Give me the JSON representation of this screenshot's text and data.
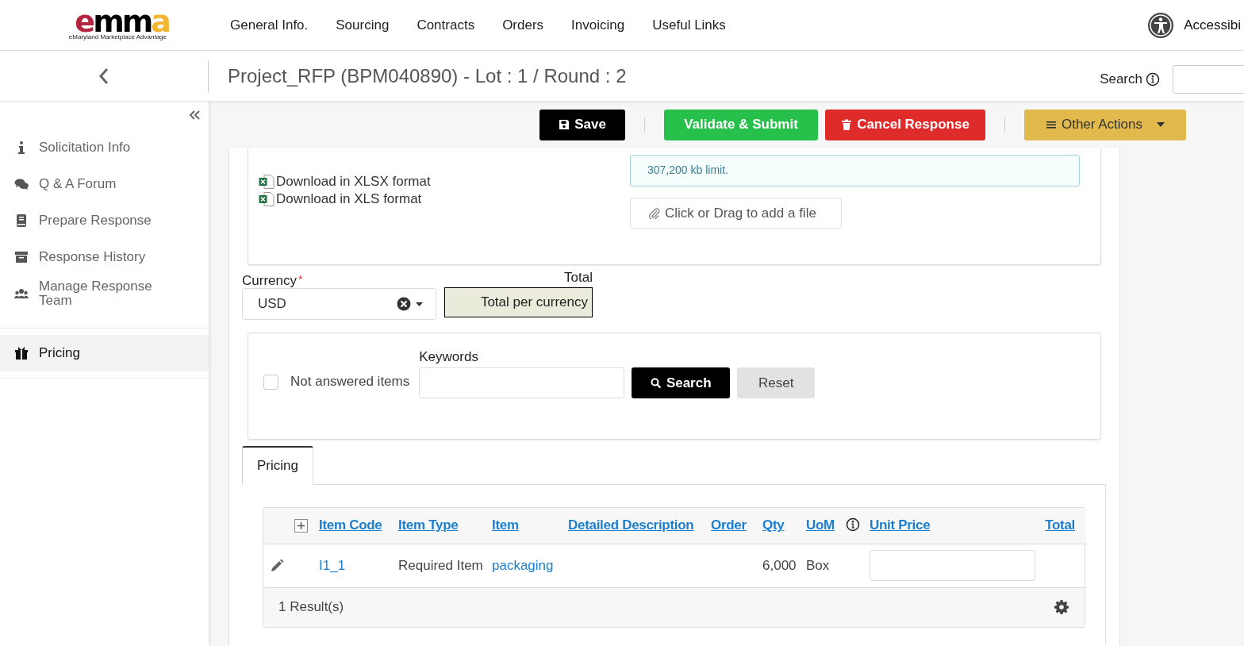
{
  "logo": {
    "text": "emma",
    "tagline": "eMaryland Marketplace Advantage"
  },
  "nav": [
    "General Info.",
    "Sourcing",
    "Contracts",
    "Orders",
    "Invoicing",
    "Useful Links"
  ],
  "accessibility": "Accessibi",
  "page_title": "Project_RFP (BPM040890) - Lot : 1 / Round : 2",
  "search": {
    "label": "Search"
  },
  "sidebar": {
    "items": [
      {
        "label": "Solicitation Info",
        "selected": false
      },
      {
        "label": "Q & A Forum",
        "selected": false
      },
      {
        "label": "Prepare Response",
        "selected": false
      },
      {
        "label": "Response History",
        "selected": false
      },
      {
        "label": "Manage Response Team",
        "selected": false
      },
      {
        "label": "Pricing",
        "selected": true
      }
    ]
  },
  "actions": [
    {
      "label": "Save",
      "kind": "save"
    },
    {
      "label": "Validate & Submit",
      "kind": "submit"
    },
    {
      "label": "Cancel Response",
      "kind": "cancel"
    },
    {
      "label": "Other Actions",
      "kind": "menu"
    }
  ],
  "import": {
    "downloads": [
      "Download in XLSX format",
      "Download in XLS format"
    ],
    "limit": "307,200 kb limit.",
    "add_file": "Click or Drag to add a file"
  },
  "currency": {
    "label": "Currency",
    "required_mark": "*",
    "value": "USD",
    "total_label": "Total",
    "total_value": "Total per currency"
  },
  "filter": {
    "not_answered": {
      "label": "Not answered items",
      "checked": false
    },
    "keywords_label": "Keywords",
    "search_button": "Search",
    "reset_button": "Reset"
  },
  "tabs": [
    {
      "label": "Pricing",
      "selected": true
    }
  ],
  "table": {
    "columns": [
      "Item Code",
      "Item Type",
      "Item",
      "Detailed Description",
      "Order",
      "Qty",
      "UoM",
      "Unit Price",
      "Total"
    ],
    "rows": [
      {
        "item_code": "I1_1",
        "item_type": "Required Item",
        "item": "packaging",
        "qty": "6,000",
        "uom": "Box"
      }
    ],
    "footer": "1 Result(s)"
  }
}
